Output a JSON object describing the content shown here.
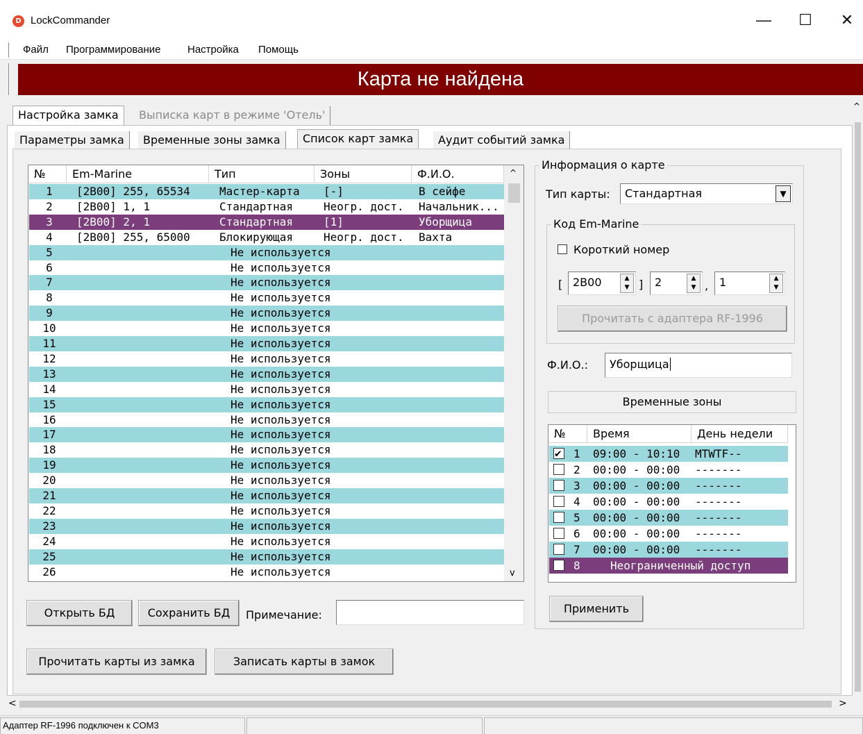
{
  "window": {
    "title": "LockCommander",
    "icon_letter": "D",
    "controls": {
      "minimize": "—",
      "maximize": "☐",
      "close": "✕"
    }
  },
  "menu": [
    "Файл",
    "Программирование",
    "Настройка",
    "Помощь"
  ],
  "banner": {
    "text": "Карта не найдена",
    "color": "#800000"
  },
  "main_tabs": [
    "Настройка замка",
    "Выписка карт в режиме 'Отель'"
  ],
  "sub_tabs": [
    "Параметры замка",
    "Временные зоны замка",
    "Список карт замка",
    "Аудит событий замка"
  ],
  "card_list": {
    "columns": [
      "№",
      "Em-Marine",
      "Тип",
      "Зоны",
      "Ф.И.О."
    ],
    "rows": [
      {
        "num": "1",
        "code": "[2B00] 255, 65534",
        "type": "Мастер-карта",
        "zones": "[-]",
        "name": "В сейфе"
      },
      {
        "num": "2",
        "code": "[2B00] 1, 1",
        "type": "Стандартная",
        "zones": "Неогр. дост.",
        "name": "Начальник..."
      },
      {
        "num": "3",
        "code": "[2B00] 2, 1",
        "type": "Стандартная",
        "zones": "[1]",
        "name": "Уборщица"
      },
      {
        "num": "4",
        "code": "[2B00] 255, 65000",
        "type": "Блокирующая",
        "zones": "Неогр. дост.",
        "name": "Вахта"
      },
      {
        "num": "5",
        "unused": "Не используется"
      },
      {
        "num": "6",
        "unused": "Не используется"
      },
      {
        "num": "7",
        "unused": "Не используется"
      },
      {
        "num": "8",
        "unused": "Не используется"
      },
      {
        "num": "9",
        "unused": "Не используется"
      },
      {
        "num": "10",
        "unused": "Не используется"
      },
      {
        "num": "11",
        "unused": "Не используется"
      },
      {
        "num": "12",
        "unused": "Не используется"
      },
      {
        "num": "13",
        "unused": "Не используется"
      },
      {
        "num": "14",
        "unused": "Не используется"
      },
      {
        "num": "15",
        "unused": "Не используется"
      },
      {
        "num": "16",
        "unused": "Не используется"
      },
      {
        "num": "17",
        "unused": "Не используется"
      },
      {
        "num": "18",
        "unused": "Не используется"
      },
      {
        "num": "19",
        "unused": "Не используется"
      },
      {
        "num": "20",
        "unused": "Не используется"
      },
      {
        "num": "21",
        "unused": "Не используется"
      },
      {
        "num": "22",
        "unused": "Не используется"
      },
      {
        "num": "23",
        "unused": "Не используется"
      },
      {
        "num": "24",
        "unused": "Не используется"
      },
      {
        "num": "25",
        "unused": "Не используется"
      },
      {
        "num": "26",
        "unused": "Не используется"
      }
    ],
    "selected_num": "3",
    "alt_color": "#9bd8de",
    "selected_color": "#7b3d7b"
  },
  "buttons": {
    "open_db": "Открыть БД",
    "save_db": "Сохранить БД",
    "read_cards": "Прочитать карты из замка",
    "write_cards": "Записать карты в замок",
    "read_adapter": "Прочитать с адаптера RF-1996",
    "apply": "Применить"
  },
  "note": {
    "label": "Примечание:",
    "value": ""
  },
  "card_info": {
    "group_title": "Информация о карте",
    "type_label": "Тип карты:",
    "type_value": "Стандартная",
    "code_group_title": "Код Em-Marine",
    "short_number_label": "Короткий номер",
    "short_number_checked": false,
    "code_open": "[",
    "code_close": "]",
    "code_sep": ",",
    "code_prefix": "2B00",
    "code_facility": "2",
    "code_number": "1",
    "fio_label": "Ф.И.О.:",
    "fio_value": "Уборщица"
  },
  "time_zones": {
    "title": "Временные зоны",
    "columns": [
      "№",
      "Время",
      "День недели"
    ],
    "rows": [
      {
        "num": "1",
        "time": "09:00 - 10:10",
        "days": "MTWTF--",
        "checked": true
      },
      {
        "num": "2",
        "time": "00:00 - 00:00",
        "days": "-------",
        "checked": false
      },
      {
        "num": "3",
        "time": "00:00 - 00:00",
        "days": "-------",
        "checked": false
      },
      {
        "num": "4",
        "time": "00:00 - 00:00",
        "days": "-------",
        "checked": false
      },
      {
        "num": "5",
        "time": "00:00 - 00:00",
        "days": "-------",
        "checked": false
      },
      {
        "num": "6",
        "time": "00:00 - 00:00",
        "days": "-------",
        "checked": false
      },
      {
        "num": "7",
        "time": "00:00 - 00:00",
        "days": "-------",
        "checked": false
      },
      {
        "num": "8",
        "unlimited": "Неограниченный доступ",
        "checked": false
      }
    ]
  },
  "status": {
    "adapter": "Адаптер RF-1996 подключен к COM3",
    "cell2": "",
    "cell3": ""
  }
}
